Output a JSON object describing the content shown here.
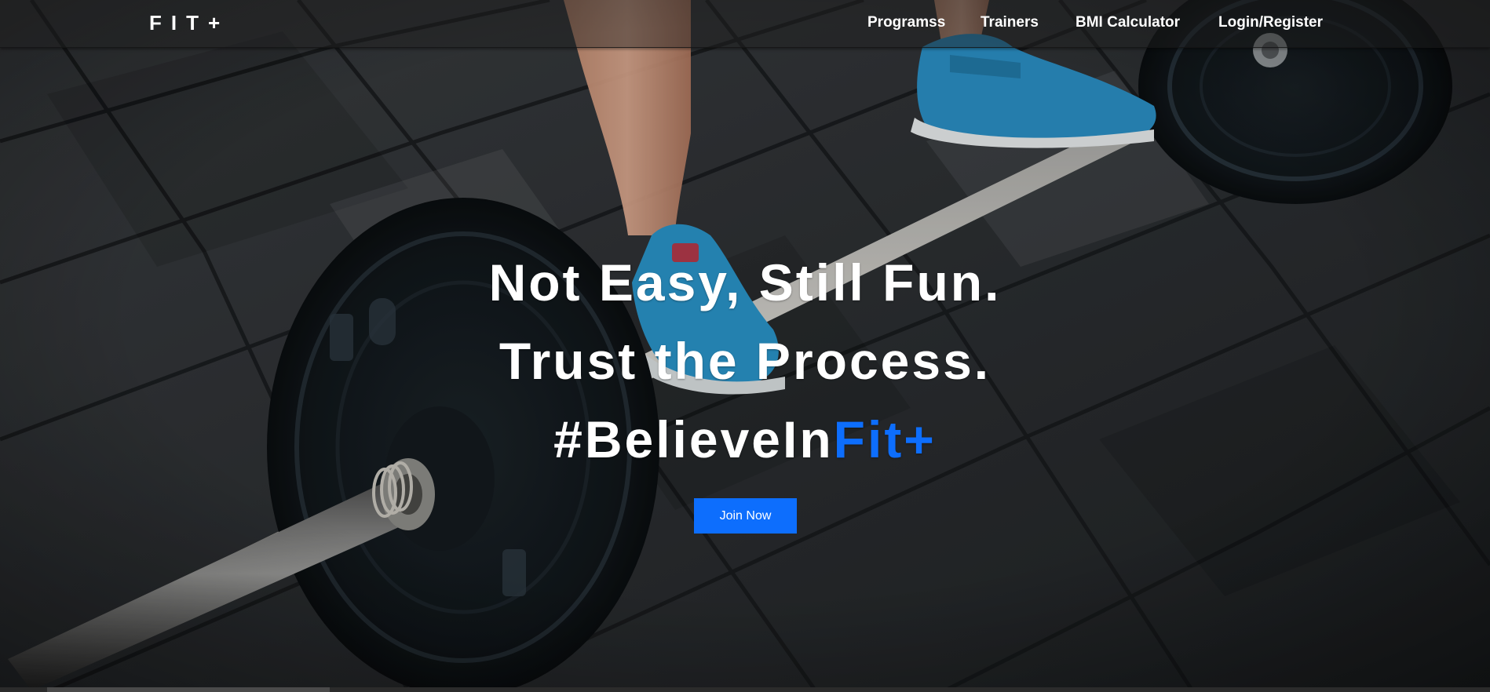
{
  "brand": {
    "logo_text": "FIT+"
  },
  "nav": {
    "programs": "Programss",
    "trainers": "Trainers",
    "bmi": "BMI Calculator",
    "login": "Login/Register"
  },
  "hero": {
    "line1": "Not Easy, Still Fun.",
    "line2": "Trust the Process.",
    "line3_prefix": "#BelieveIn",
    "line3_accent": "Fit+",
    "cta_label": "Join Now"
  },
  "colors": {
    "accent": "#0d6efd",
    "text": "#ffffff",
    "nav_bg": "rgba(30,30,30,0.45)"
  },
  "icons": {
    "background": "barbell-photo"
  }
}
